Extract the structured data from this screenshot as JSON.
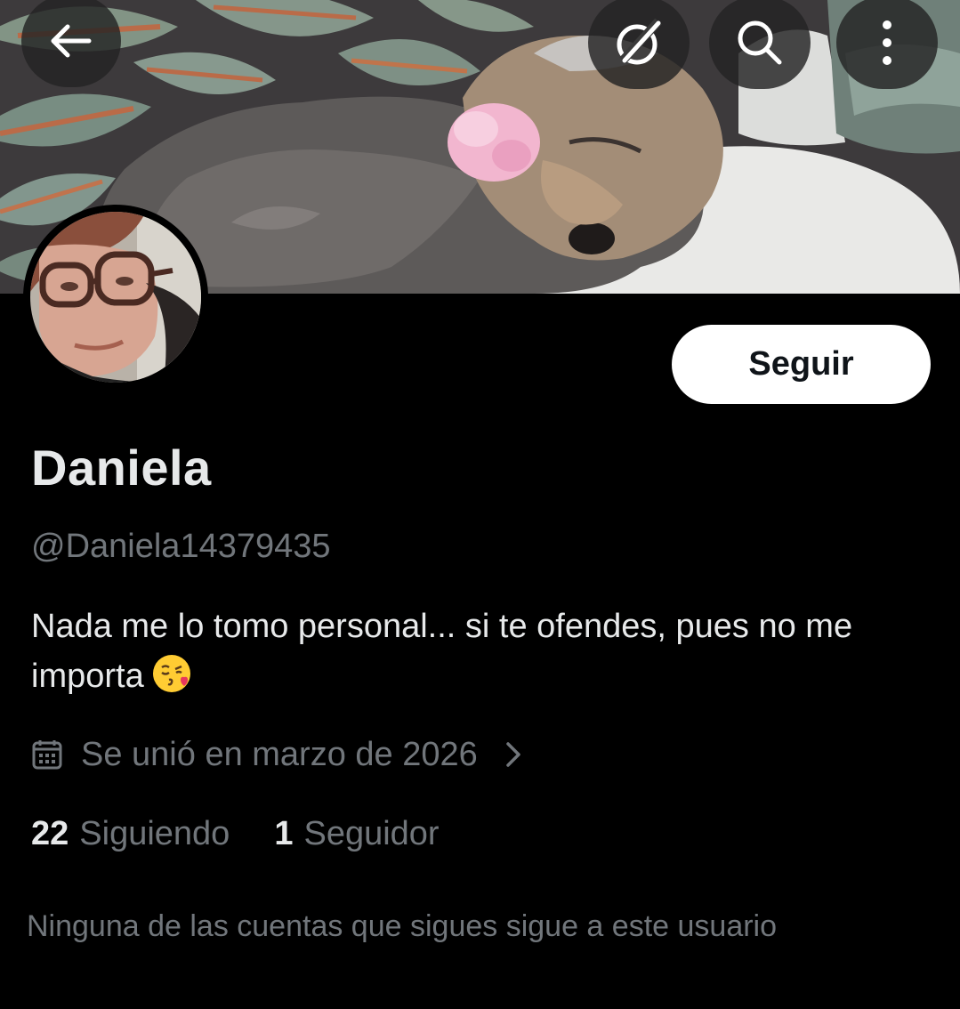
{
  "header": {
    "back_icon": "arrow-left-icon",
    "grok_icon": "grok-slash-circle-icon",
    "search_icon": "search-icon",
    "more_icon": "more-vertical-icon"
  },
  "profile": {
    "follow_label": "Seguir",
    "display_name": "Daniela",
    "handle": "@Daniela14379435",
    "bio": "Nada me lo tomo personal... si te ofendes, pues no me importa",
    "bio_emoji": "kissing-face-emoji",
    "joined_text": "Se unió en marzo de 2026",
    "joined_icon": "calendar-icon",
    "joined_chevron": "chevron-right-icon"
  },
  "stats": {
    "following_count": "22",
    "following_label": "Siguiendo",
    "followers_count": "1",
    "followers_label": "Seguidor"
  },
  "mutual_text": "Ninguna de las cuentas que sigues sigue a este usuario",
  "colors": {
    "background": "#000000",
    "primary_text": "#e7e9ea",
    "secondary_text": "#71767b",
    "follow_button_bg": "#ffffff",
    "follow_button_text": "#0f1419"
  }
}
